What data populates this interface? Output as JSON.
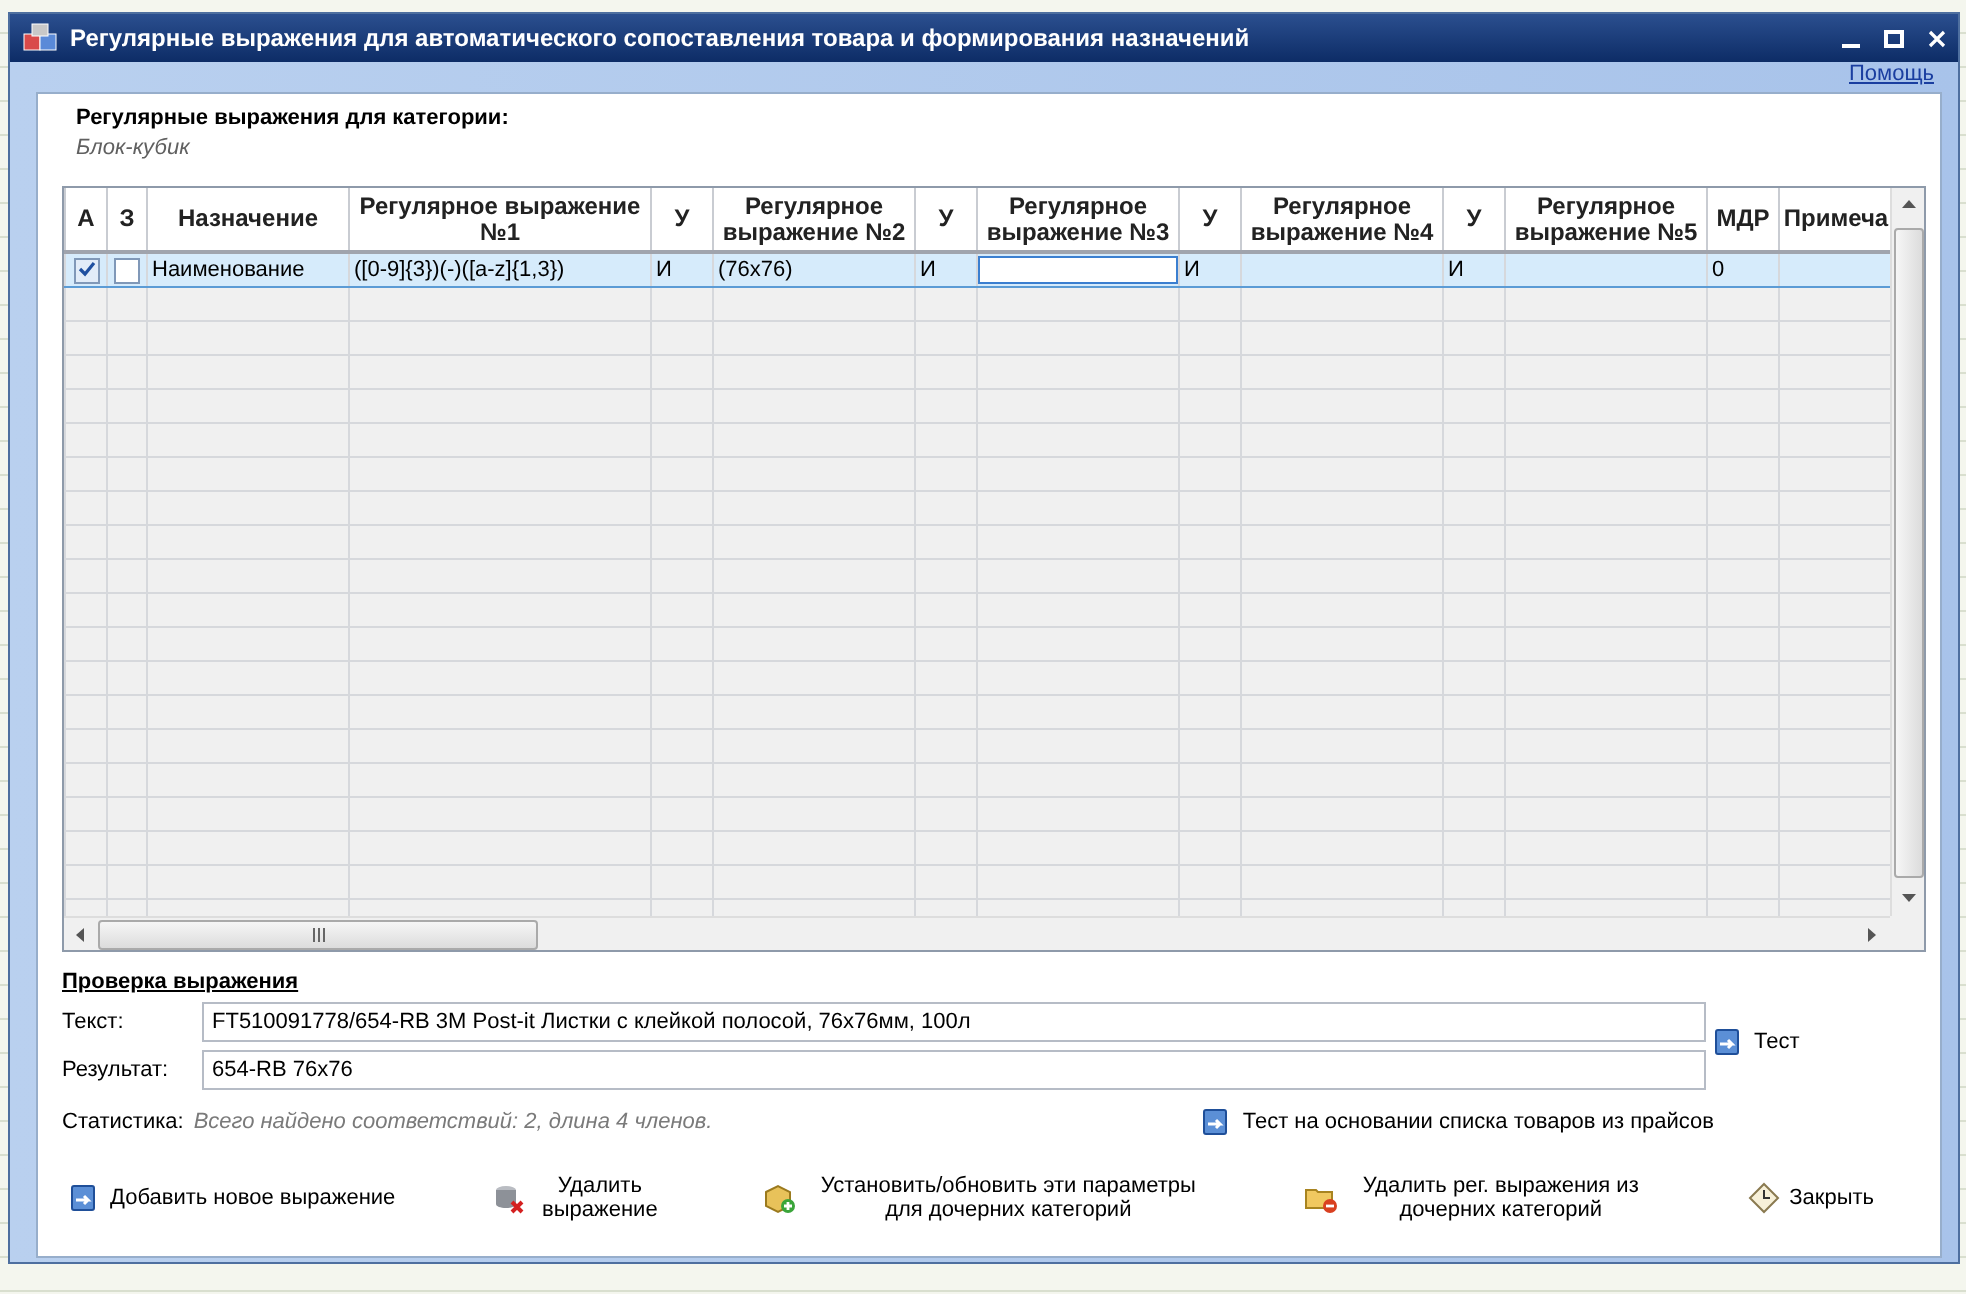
{
  "window": {
    "title": "Регулярные выражения для автоматического сопоставления товара и формирования назначений",
    "help_link": "Помощь"
  },
  "category": {
    "label": "Регулярные выражения для категории:",
    "name": "Блок-кубик"
  },
  "table": {
    "columns": [
      "А",
      "З",
      "Назначение",
      "Регулярное выражение №1",
      "У",
      "Регулярное выражение №2",
      "У",
      "Регулярное выражение №3",
      "У",
      "Регулярное выражение №4",
      "У",
      "Регулярное выражение №5",
      "МДР",
      "Примеча"
    ],
    "rows": [
      {
        "selected": true,
        "cells": [
          {
            "kind": "check",
            "checked": true
          },
          {
            "kind": "check",
            "checked": false
          },
          {
            "kind": "text",
            "text": "Наименование"
          },
          {
            "kind": "text",
            "text": "([0-9]{3})(-)([a-z]{1,3})"
          },
          {
            "kind": "text",
            "text": "И"
          },
          {
            "kind": "text",
            "text": "(76x76)"
          },
          {
            "kind": "text",
            "text": "И"
          },
          {
            "kind": "edit"
          },
          {
            "kind": "text",
            "text": "И"
          },
          {
            "kind": "empty"
          },
          {
            "kind": "text",
            "text": "И"
          },
          {
            "kind": "empty"
          },
          {
            "kind": "text",
            "text": "0"
          },
          {
            "kind": "empty"
          }
        ]
      }
    ]
  },
  "check": {
    "title": "Проверка выражения",
    "fields": [
      {
        "label": "Текст:",
        "value": "FT510091778/654-RB 3M Post-it Листки с клейкой полосой, 76x76мм, 100л"
      },
      {
        "label": "Результат:",
        "value": "654-RB 76x76"
      }
    ],
    "stats_label": "Статистика:",
    "stats": "Всего найдено соответствий: 2, длина 4 членов.",
    "test_button": "Тест",
    "list_test_button": "Тест на основании списка товаров из прайсов"
  },
  "actions": [
    "Добавить новое выражение",
    "Удалить выражение",
    "Установить/обновить эти параметры для дочерних категорий",
    "Удалить рег. выражения из дочерних категорий",
    "Закрыть"
  ]
}
